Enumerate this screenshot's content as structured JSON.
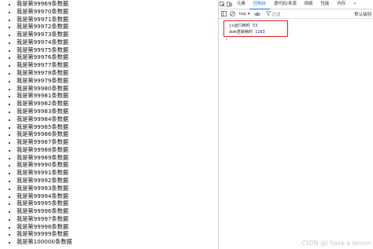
{
  "page": {
    "items": [
      "我是第99969条数据",
      "我是第99970条数据",
      "我是第99971条数据",
      "我是第99972条数据",
      "我是第99973条数据",
      "我是第99974条数据",
      "我是第99975条数据",
      "我是第99976条数据",
      "我是第99977条数据",
      "我是第99978条数据",
      "我是第99979条数据",
      "我是第99980条数据",
      "我是第99981条数据",
      "我是第99982条数据",
      "我是第99983条数据",
      "我是第99984条数据",
      "我是第99985条数据",
      "我是第99986条数据",
      "我是第99987条数据",
      "我是第99988条数据",
      "我是第99989条数据",
      "我是第99990条数据",
      "我是第99991条数据",
      "我是第99992条数据",
      "我是第99993条数据",
      "我是第99994条数据",
      "我是第99995条数据",
      "我是第99996条数据",
      "我是第99997条数据",
      "我是第99998条数据",
      "我是第99999条数据",
      "我是第100000条数据"
    ]
  },
  "devtools": {
    "tabs": [
      "元素",
      "控制台",
      "源代码/来源",
      "网络",
      "性能",
      "内存"
    ],
    "active_tab": "控制台",
    "more": "»",
    "context": "top",
    "filter_placeholder": "过滤",
    "levels": "默认级别",
    "logs": [
      {
        "label": "js运行耗时",
        "value": "53"
      },
      {
        "label": "dom渲染耗时",
        "value": "1183"
      }
    ],
    "prompt": "›"
  },
  "watermark": "CSDN @I have a lemon"
}
